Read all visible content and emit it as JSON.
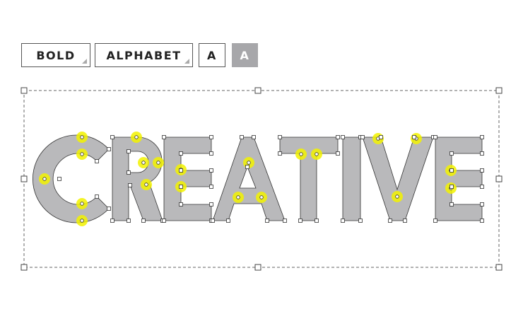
{
  "toolbar": {
    "weight_label": "BOLD",
    "family_label": "ALPHABET",
    "case_label": "A",
    "case_active_label": "A"
  },
  "artwork": {
    "text": "CREATIVE",
    "letter_fill": "#b9b9bb",
    "outline_color": "#333333",
    "highlight_color": "#f2f200"
  }
}
